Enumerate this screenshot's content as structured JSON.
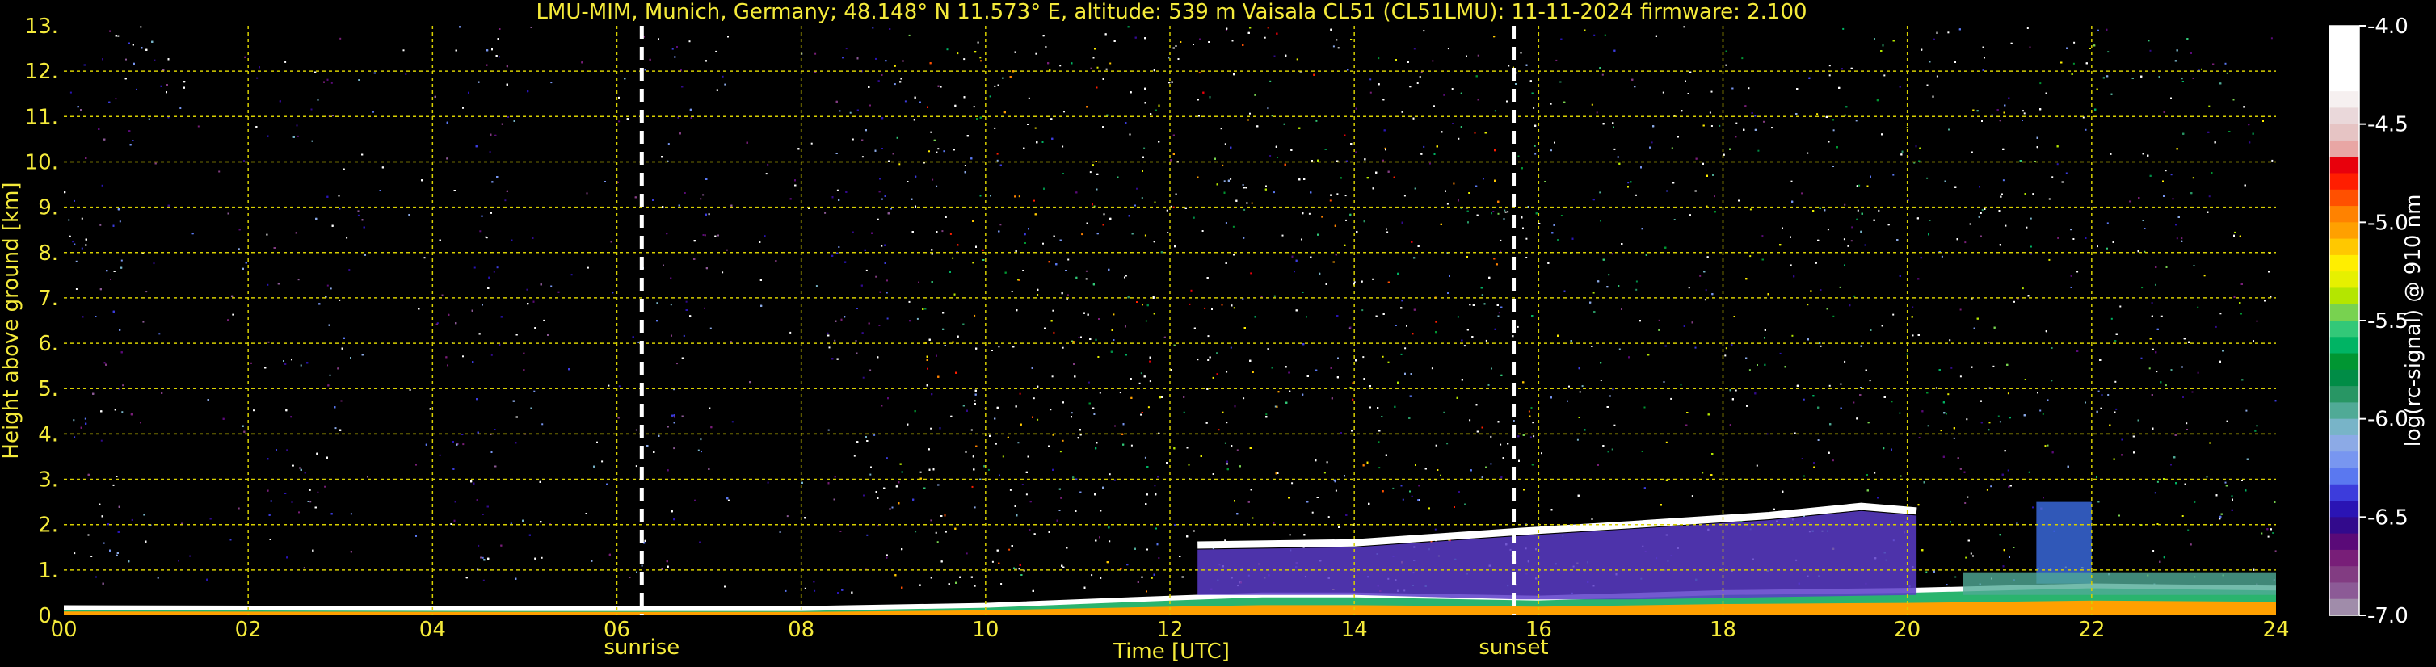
{
  "chart_data": {
    "type": "heatmap",
    "title": "LMU-MIM, Munich, Germany; 48.148° N 11.573° E, altitude: 539 m    Vaisala CL51 (CL51LMU): 11-11-2024    firmware: 2.100",
    "xlabel": "Time [UTC]",
    "ylabel": "Height above ground [km]",
    "xlim": [
      0,
      24
    ],
    "ylim": [
      0,
      13
    ],
    "x_ticks": [
      "00",
      "02",
      "04",
      "06",
      "08",
      "10",
      "12",
      "14",
      "16",
      "18",
      "20",
      "22",
      "24"
    ],
    "y_ticks": [
      "0.",
      "1.",
      "2.",
      "3.",
      "4.",
      "5.",
      "6.",
      "7.",
      "8.",
      "9.",
      "10.",
      "11.",
      "12.",
      "13."
    ],
    "grid": true,
    "colorbar": {
      "label": "log(rc-signal) @ 910 nm",
      "range": [
        -7.0,
        -4.0
      ],
      "ticks": [
        "-4.0",
        "-4.5",
        "-5.0",
        "-5.5",
        "-6.0",
        "-6.5",
        "-7.0"
      ],
      "colors": [
        "#ffffff",
        "#ffffff",
        "#ffffff",
        "#ffffff",
        "#f6f0f0",
        "#ead8da",
        "#e6c4c4",
        "#e8a6a4",
        "#e8000c",
        "#ff1e00",
        "#ff5000",
        "#ff8200",
        "#ffa000",
        "#ffc800",
        "#ffee00",
        "#e6f000",
        "#b4e600",
        "#78d250",
        "#32c878",
        "#00b464",
        "#009632",
        "#008c46",
        "#289664",
        "#50aa96",
        "#78b4c8",
        "#8caae6",
        "#7896f0",
        "#5a78f0",
        "#3c3cdc",
        "#2a14b4",
        "#320a8c",
        "#5a0a78",
        "#781e78",
        "#823c82",
        "#8c5a96",
        "#a08caa"
      ]
    },
    "annotations": [
      {
        "label": "sunrise",
        "time": 6.27
      },
      {
        "label": "sunset",
        "time": 15.73
      }
    ],
    "features": {
      "surface_layer": [
        [
          0,
          0.17
        ],
        [
          5,
          0.15
        ],
        [
          8,
          0.15
        ],
        [
          10,
          0.22
        ],
        [
          12,
          0.38
        ],
        [
          13,
          0.45
        ],
        [
          14,
          0.45
        ],
        [
          16,
          0.38
        ],
        [
          18,
          0.5
        ],
        [
          20,
          0.55
        ],
        [
          22,
          0.65
        ],
        [
          24,
          0.6
        ]
      ],
      "elevated_layer_top": [
        [
          12.3,
          1.55
        ],
        [
          14,
          1.6
        ],
        [
          15.8,
          1.85
        ],
        [
          17,
          2.0
        ],
        [
          18.5,
          2.2
        ],
        [
          19.5,
          2.4
        ],
        [
          20.1,
          2.3
        ]
      ],
      "elevated_layer_base": [
        [
          12.3,
          0.45
        ],
        [
          14,
          0.45
        ],
        [
          15.8,
          0.35
        ],
        [
          17,
          0.35
        ],
        [
          18.5,
          0.4
        ],
        [
          20.1,
          0.45
        ]
      ],
      "patches": [
        {
          "x": [
            21.4,
            22.0
          ],
          "y": [
            0.7,
            2.5
          ]
        },
        {
          "x": [
            20.6,
            24.0
          ],
          "y": [
            0.45,
            0.95
          ]
        }
      ]
    }
  }
}
